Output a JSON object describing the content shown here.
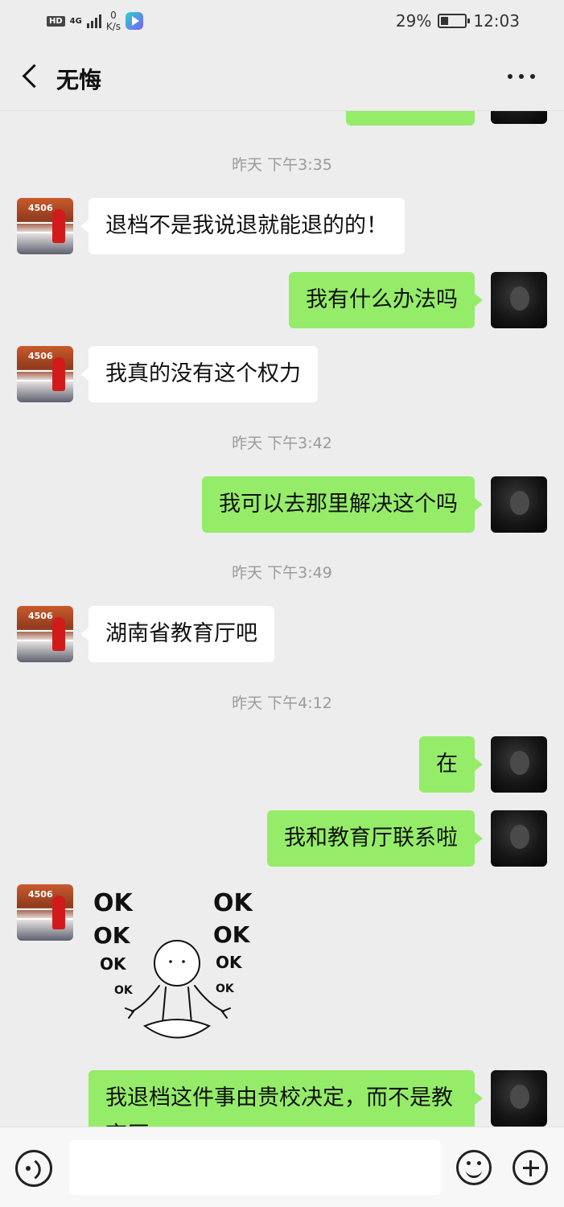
{
  "status_bar": {
    "hd": "HD",
    "network": "4G",
    "speed_value": "0",
    "speed_unit": "K/s",
    "battery": "29%",
    "time": "12:03"
  },
  "header": {
    "title": "无悔"
  },
  "messages": {
    "t1": "昨天 下午3:35",
    "m1": "退档不是我说退就能退的的！",
    "m2": "我有什么办法吗",
    "m3": "我真的没有这个权力",
    "t2": "昨天 下午3:42",
    "m4": "我可以去那里解决这个吗",
    "t3": "昨天 下午3:49",
    "m5": "湖南省教育厅吧",
    "t4": "昨天 下午4:12",
    "m6": "在",
    "m7": "我和教育厅联系啦",
    "m8": "我退档这件事由贵校决定，而不是教育厅"
  },
  "sticker": {
    "ok": "OK"
  },
  "avatar_tag": "4506",
  "icons": {
    "back": "chevron-left-icon",
    "more": "more-dots-icon",
    "voice": "voice-icon",
    "emoji": "emoji-icon",
    "plus": "plus-icon"
  },
  "colors": {
    "outgoing_bubble": "#95ec69",
    "incoming_bubble": "#ffffff",
    "background": "#ededed"
  }
}
